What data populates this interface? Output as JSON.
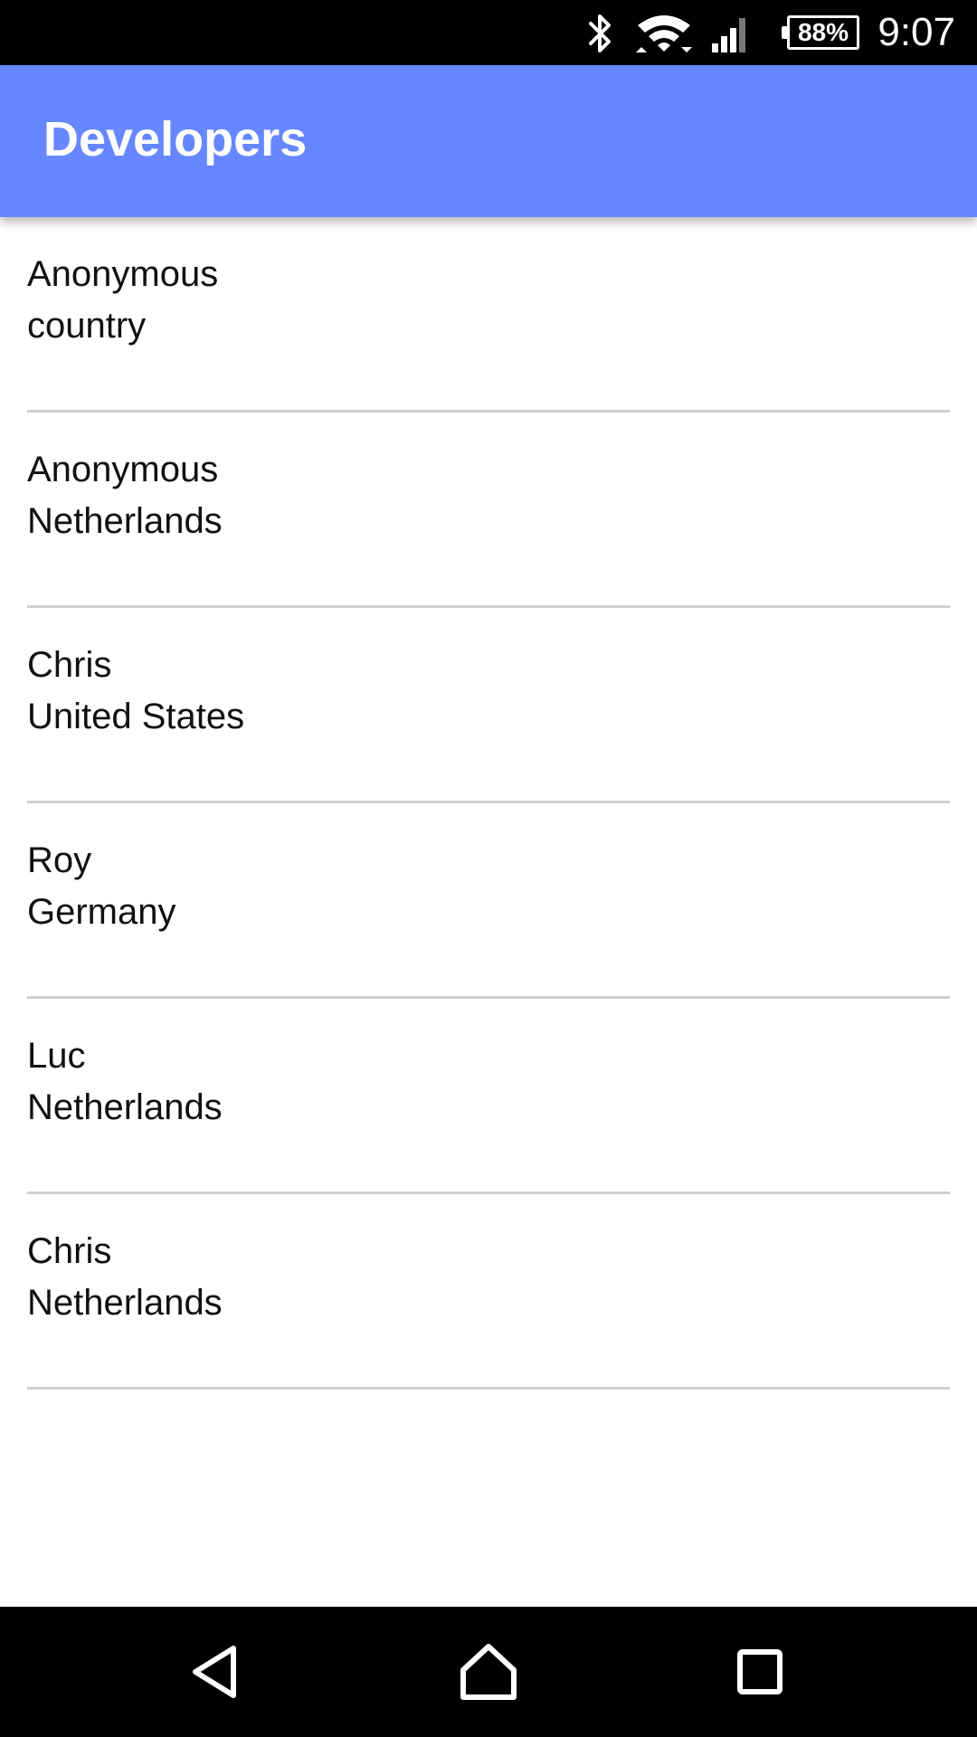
{
  "status_bar": {
    "battery": "88%",
    "time": "9:07",
    "icons": [
      "bluetooth-icon",
      "wifi-icon",
      "cell-signal-icon",
      "battery-icon"
    ]
  },
  "app_bar": {
    "title": "Developers",
    "color": "#6687ff"
  },
  "developers": [
    {
      "name": "Anonymous",
      "country": "country"
    },
    {
      "name": "Anonymous",
      "country": "Netherlands"
    },
    {
      "name": "Chris",
      "country": "United States"
    },
    {
      "name": "Roy",
      "country": "Germany"
    },
    {
      "name": "Luc",
      "country": "Netherlands"
    },
    {
      "name": "Chris",
      "country": "Netherlands"
    }
  ],
  "nav_bar": {
    "icons": [
      "back-icon",
      "home-icon",
      "recents-icon"
    ]
  }
}
